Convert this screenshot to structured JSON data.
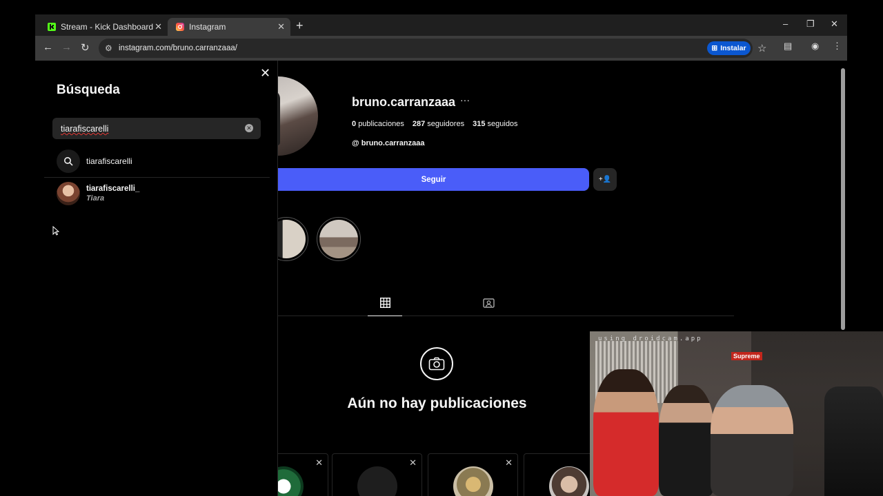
{
  "browser": {
    "tabs": [
      {
        "label": "Stream - Kick Dashboard",
        "icon": "kick-icon",
        "active": false
      },
      {
        "label": "Instagram",
        "icon": "instagram-icon",
        "active": true
      }
    ],
    "new_tab": "+",
    "url": "instagram.com/bruno.carranzaaa/",
    "install_label": "Instalar",
    "window_controls": {
      "minimize": "–",
      "restore": "❐",
      "close": "✕"
    },
    "nav": {
      "back": "←",
      "forward": "→",
      "reload": "↻"
    }
  },
  "search_panel": {
    "title": "Búsqueda",
    "close": "✕",
    "query": "tiarafiscarelli",
    "suggestion": "tiarafiscarelli",
    "results": [
      {
        "username": "tiarafiscarelli_",
        "full_name": "Tiara"
      }
    ]
  },
  "profile": {
    "username": "bruno.carranzaaa",
    "more": "···",
    "stats": {
      "posts_count": "0",
      "posts_label": "publicaciones",
      "followers_count": "287",
      "followers_label": "seguidores",
      "following_count": "315",
      "following_label": "seguidos"
    },
    "threads_handle": "bruno.carranzaaa",
    "follow_label": "Seguir",
    "suggest_icon": "+👤",
    "no_posts": "Aún no hay publicaciones"
  },
  "webcam": {
    "watermark": "using droidcam.app",
    "sign": "Supreme"
  },
  "colors": {
    "follow_button": "#4a5df9",
    "install_button": "#0b57d0",
    "background": "#000000"
  }
}
